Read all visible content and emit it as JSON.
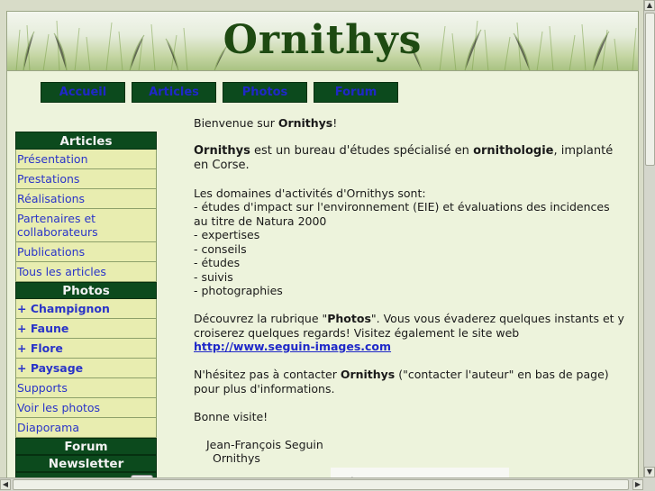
{
  "site": {
    "title": "Ornithys"
  },
  "nav": [
    {
      "label": "Accueil"
    },
    {
      "label": "Articles"
    },
    {
      "label": "Photos"
    },
    {
      "label": "Forum"
    }
  ],
  "sidebar": {
    "articles_header": "Articles",
    "articles": [
      {
        "label": "Présentation"
      },
      {
        "label": "Prestations"
      },
      {
        "label": "Réalisations"
      },
      {
        "label": "Partenaires et collaborateurs"
      },
      {
        "label": "Publications"
      },
      {
        "label": "Tous les articles"
      }
    ],
    "photos_header": "Photos",
    "photo_categories": [
      {
        "label": "+ Champignon"
      },
      {
        "label": "+ Faune"
      },
      {
        "label": "+ Flore"
      },
      {
        "label": "+ Paysage"
      }
    ],
    "photo_links": [
      {
        "label": "Supports"
      },
      {
        "label": "Voir les photos"
      },
      {
        "label": "Diaporama"
      }
    ],
    "forum_header": "Forum",
    "newsletter_header": "Newsletter"
  },
  "content": {
    "welcome_prefix": "Bienvenue sur ",
    "welcome_name": "Ornithys",
    "welcome_suffix": "!",
    "intro_name": "Ornithys",
    "intro_mid": " est un bureau d'études spécialisé en ",
    "intro_key": "ornithologie",
    "intro_end": ", implanté en Corse.",
    "domains_title": "Les domaines d'activités d'Ornithys sont:",
    "domains": [
      "- études d'impact sur l'environnement (EIE) et évaluations des incidences au titre de Natura 2000",
      "- expertises",
      "- conseils",
      "- études",
      "- suivis",
      "- photographies"
    ],
    "photos_prefix": "Découvrez la rubrique \"",
    "photos_word": "Photos",
    "photos_suffix": "\". Vous vous évaderez quelques instants et y croiserez quelques regards! Visitez également le site web ",
    "photos_link": "http://www.seguin-images.com",
    "contact_prefix": "N'hésitez pas à contacter ",
    "contact_name": "Ornithys",
    "contact_suffix": " (\"contacter l'auteur\" en bas de page) pour plus d'informations.",
    "bye": "Bonne visite!",
    "sig_name": "Jean-François Seguin",
    "sig_org": "Ornithys"
  },
  "colors": {
    "nav_bg": "#0c4a1d",
    "link": "#1f28c8",
    "side_item_bg": "#e8edb0",
    "title": "#1e4a12"
  }
}
